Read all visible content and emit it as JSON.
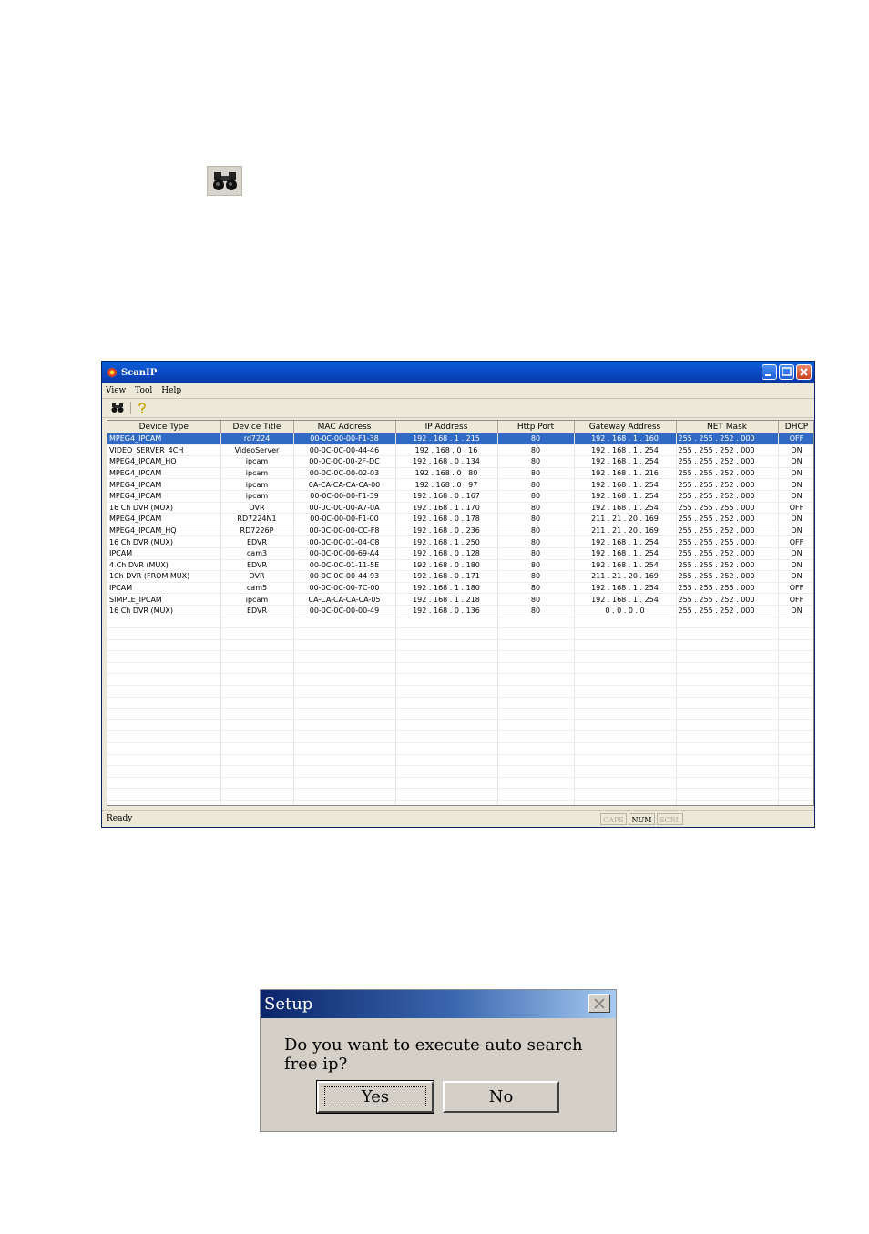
{
  "scanip": {
    "title": "ScanIP",
    "menu": [
      "View",
      "Tool",
      "Help"
    ],
    "columns": [
      "Device Type",
      "Device Title",
      "MAC Address",
      "IP Address",
      "Http Port",
      "Gateway Address",
      "NET Mask",
      "DHCP"
    ],
    "rows": [
      [
        "MPEG4_IPCAM",
        "rd7224",
        "00-0C-00-00-F1-38",
        "192 . 168 . 1 . 215",
        "80",
        "192 . 168 . 1 . 160",
        "255 . 255 . 252 . 000",
        "OFF"
      ],
      [
        "VIDEO_SERVER_4CH",
        "VideoServer",
        "00-0C-0C-00-44-46",
        "192 . 168 . 0 . 16",
        "80",
        "192 . 168 . 1 . 254",
        "255 . 255 . 252 . 000",
        "ON"
      ],
      [
        "MPEG4_IPCAM_HQ",
        "ipcam",
        "00-0C-0C-00-2F-DC",
        "192 . 168 . 0 . 134",
        "80",
        "192 . 168 . 1 . 254",
        "255 . 255 . 252 . 000",
        "ON"
      ],
      [
        "MPEG4_IPCAM",
        "ipcam",
        "00-0C-0C-00-02-03",
        "192 . 168 . 0 . 80",
        "80",
        "192 . 168 . 1 . 216",
        "255 . 255 . 252 . 000",
        "ON"
      ],
      [
        "MPEG4_IPCAM",
        "ipcam",
        "0A-CA-CA-CA-CA-00",
        "192 . 168 . 0 . 97",
        "80",
        "192 . 168 . 1 . 254",
        "255 . 255 . 252 . 000",
        "ON"
      ],
      [
        "MPEG4_IPCAM",
        "ipcam",
        "00-0C-00-00-F1-39",
        "192 . 168 . 0 . 167",
        "80",
        "192 . 168 . 1 . 254",
        "255 . 255 . 252 . 000",
        "ON"
      ],
      [
        "16 Ch DVR (MUX)",
        "DVR",
        "00-0C-0C-00-A7-0A",
        "192 . 168 . 1 . 170",
        "80",
        "192 . 168 . 1 . 254",
        "255 . 255 . 255 . 000",
        "OFF"
      ],
      [
        "MPEG4_IPCAM",
        "RD7224N1",
        "00-0C-00-00-F1-00",
        "192 . 168 . 0 . 178",
        "80",
        "211 . 21 . 20 . 169",
        "255 . 255 . 252 . 000",
        "ON"
      ],
      [
        "MPEG4_IPCAM_HQ",
        "RD7226P",
        "00-0C-0C-00-CC-F8",
        "192 . 168 . 0 . 236",
        "80",
        "211 . 21 . 20 . 169",
        "255 . 255 . 252 . 000",
        "ON"
      ],
      [
        "16 Ch DVR (MUX)",
        "EDVR",
        "00-0C-0C-01-04-C8",
        "192 . 168 . 1 . 250",
        "80",
        "192 . 168 . 1 . 254",
        "255 . 255 . 255 . 000",
        "OFF"
      ],
      [
        "IPCAM",
        "cam3",
        "00-0C-0C-00-69-A4",
        "192 . 168 . 0 . 128",
        "80",
        "192 . 168 . 1 . 254",
        "255 . 255 . 252 . 000",
        "ON"
      ],
      [
        "4 Ch DVR (MUX)",
        "EDVR",
        "00-0C-0C-01-11-5E",
        "192 . 168 . 0 . 180",
        "80",
        "192 . 168 . 1 . 254",
        "255 . 255 . 252 . 000",
        "ON"
      ],
      [
        "1Ch DVR (FROM MUX)",
        "DVR",
        "00-0C-0C-00-44-93",
        "192 . 168 . 0 . 171",
        "80",
        "211 . 21 . 20 . 169",
        "255 . 255 . 252 . 000",
        "ON"
      ],
      [
        "IPCAM",
        "cam5",
        "00-0C-0C-00-7C-00",
        "192 . 168 . 1 . 180",
        "80",
        "192 . 168 . 1 . 254",
        "255 . 255 . 255 . 000",
        "OFF"
      ],
      [
        "SIMPLE_IPCAM",
        "ipcam",
        "CA-CA-CA-CA-CA-05",
        "192 . 168 . 1 . 218",
        "80",
        "192 . 168 . 1 . 254",
        "255 . 255 . 252 . 000",
        "OFF"
      ],
      [
        "16 Ch DVR (MUX)",
        "EDVR",
        "00-0C-0C-00-00-49",
        "192 . 168 . 0 . 136",
        "80",
        "0 . 0 . 0 . 0",
        "255 . 255 . 252 . 000",
        "ON"
      ]
    ],
    "status": "Ready",
    "indicators": [
      "CAPS",
      "NUM",
      "SCRL"
    ],
    "active_indicator": "NUM"
  },
  "dialog": {
    "title": "Setup",
    "message": "Do you want to execute auto search free ip?",
    "yes_label": "Yes",
    "no_label": "No"
  },
  "colors": {
    "selection": "#316ac5",
    "titlebar": "#0a46c0",
    "window_bg": "#ece9d8",
    "dialog_bg": "#d4d0c8"
  }
}
